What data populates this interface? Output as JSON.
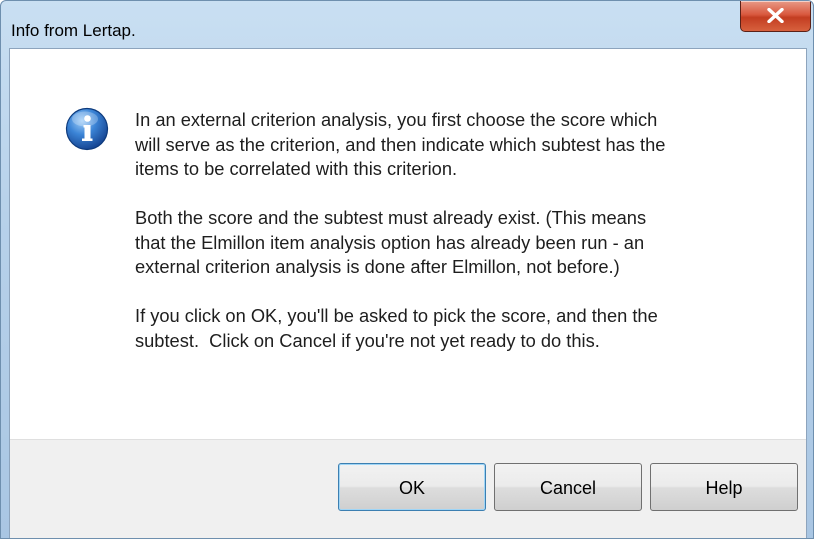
{
  "window": {
    "title": "Info from Lertap."
  },
  "icons": {
    "dialog_icon": "info-icon",
    "close_icon": "close-x-icon"
  },
  "message": {
    "paragraphs": [
      "In an external criterion analysis, you first choose the score which\nwill serve as the criterion, and then indicate which subtest has the\nitems to be correlated with this criterion.",
      "Both the score and the subtest must already exist. (This means\nthat the Elmillon item analysis option has already been run - an\nexternal criterion analysis is done after Elmillon, not before.)",
      "If you click on OK, you'll be asked to pick the score, and then the\nsubtest.  Click on Cancel if you're not yet ready to do this."
    ]
  },
  "buttons": {
    "ok_label": "OK",
    "cancel_label": "Cancel",
    "help_label": "Help"
  },
  "colors": {
    "titlebar": "#b7d1ea",
    "close_button": "#c33d21",
    "info_icon_blue": "#1f62b8",
    "footer": "#f0f0f0"
  }
}
